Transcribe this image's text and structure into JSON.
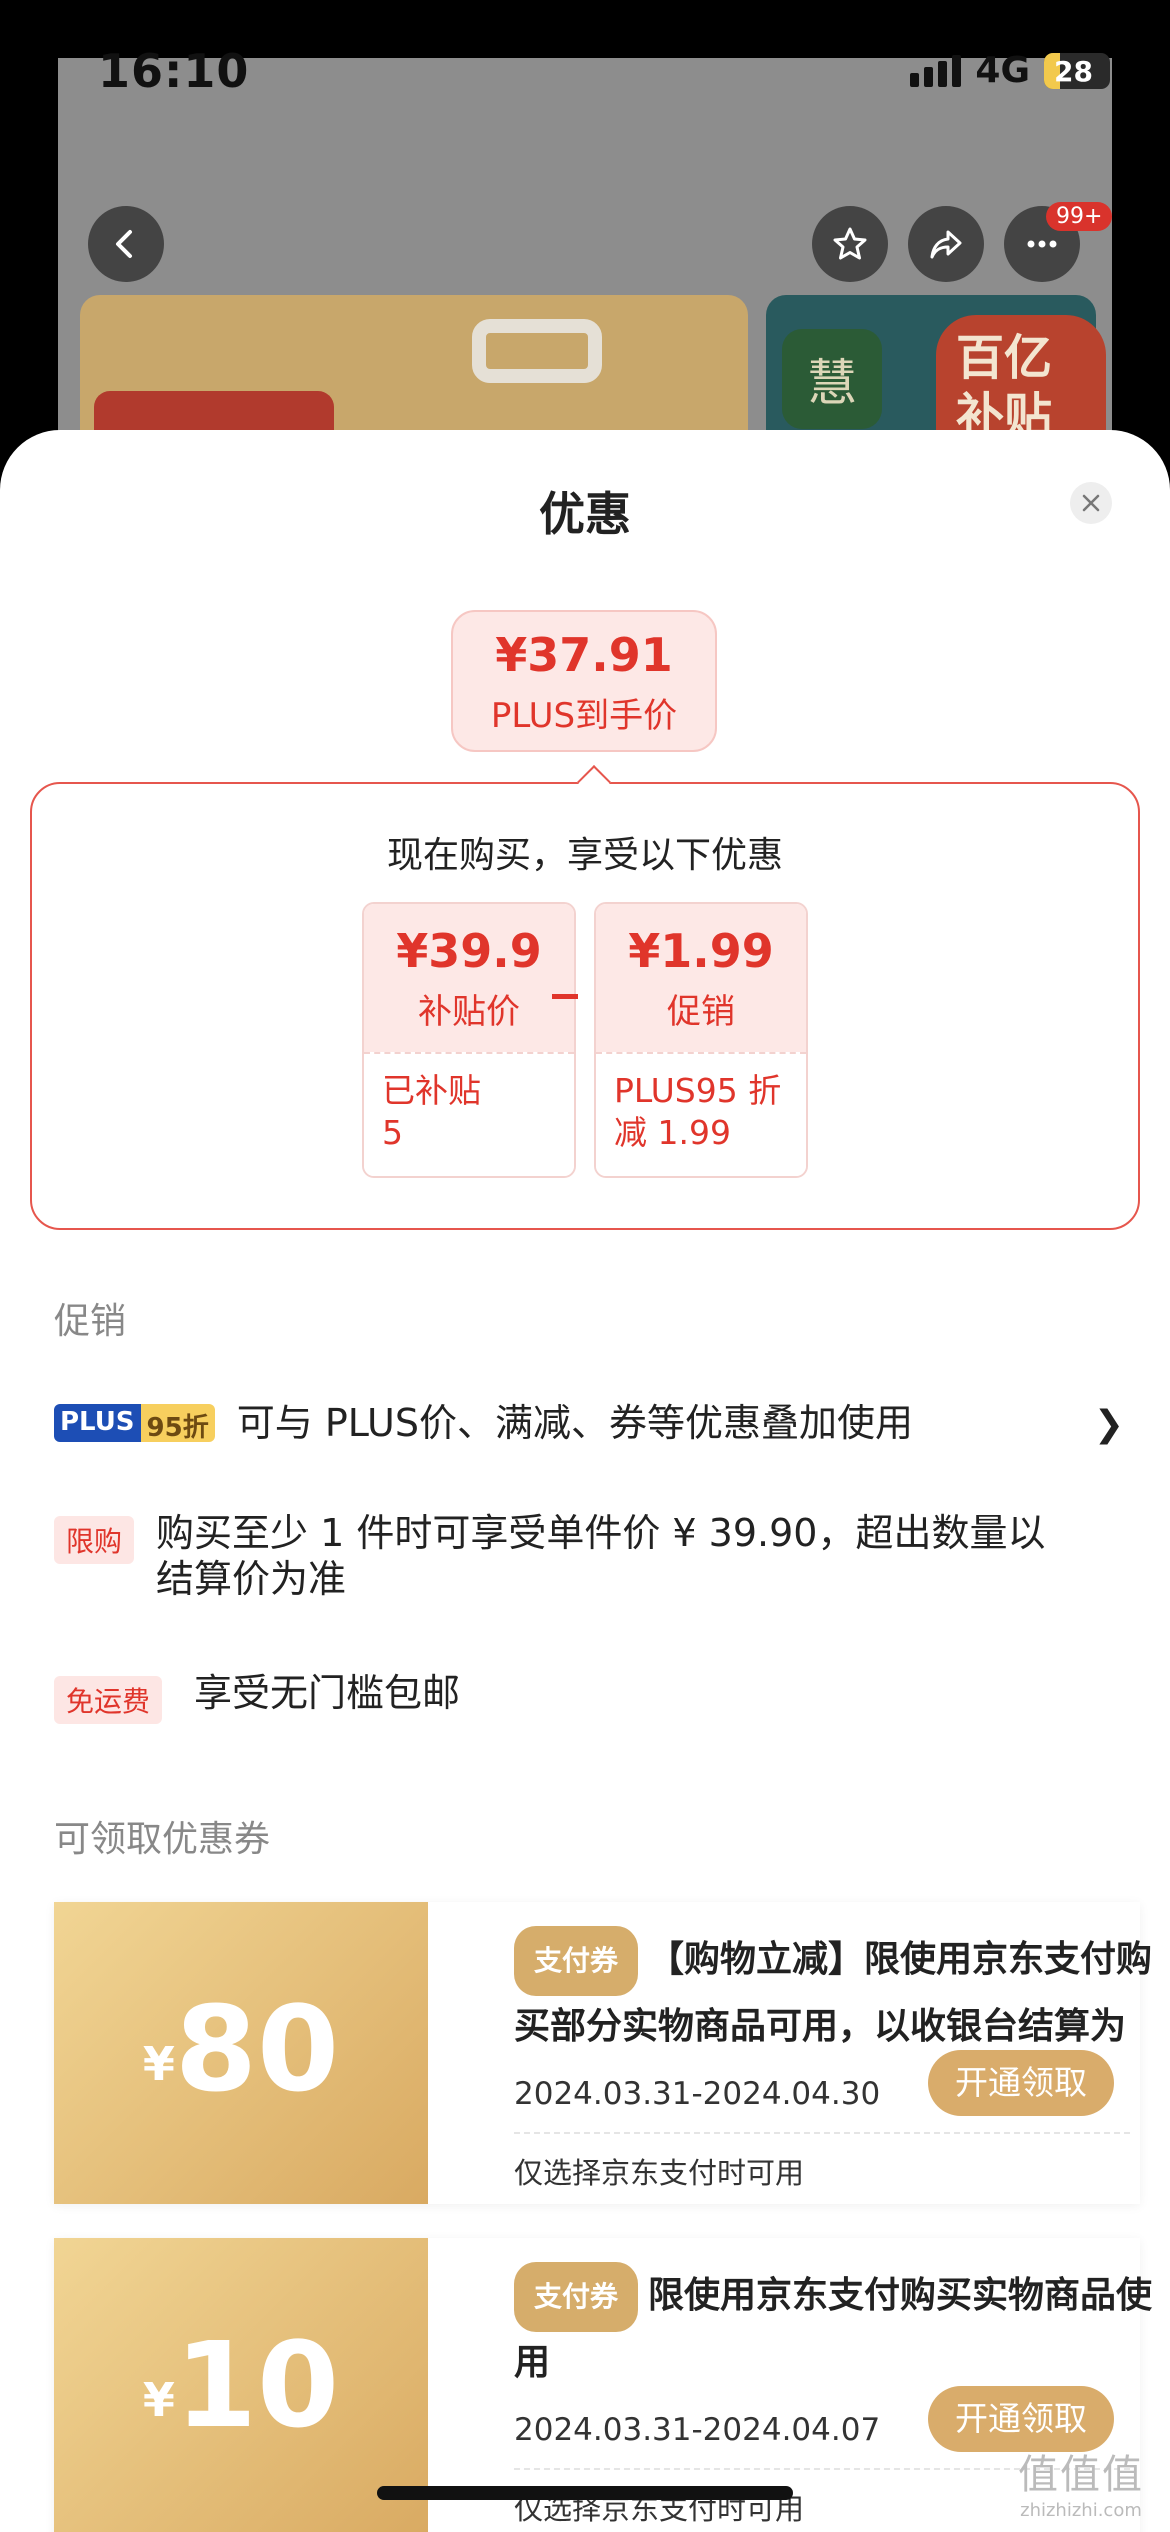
{
  "status_bar": {
    "time": "16:10",
    "network": "4G",
    "battery": "28"
  },
  "header": {
    "badge": "99+"
  },
  "product_preview": {
    "seal_char": "慧",
    "brand_text": "百亿补贴"
  },
  "sheet": {
    "title": "优惠",
    "final_price": {
      "amount": "¥37.91",
      "label": "PLUS到手价"
    },
    "breakdown": {
      "heading": "现在购买，享受以下优惠",
      "items": [
        {
          "value": "¥39.9",
          "name": "补贴价",
          "detail": "已补贴\n5"
        },
        {
          "value": "¥1.99",
          "name": "促销",
          "detail": "PLUS95 折减 1.99"
        }
      ]
    },
    "promo_section_label": "促销",
    "promos": [
      {
        "tag_a": "PLUS",
        "tag_b": "95折",
        "text": "可与 PLUS价、满减、券等优惠叠加使用"
      },
      {
        "tag": "限购",
        "text": "购买至少 1 件时可享受单件价 ¥ 39.90，超出数量以结算价为准"
      },
      {
        "tag": "免运费",
        "text": "享受无门槛包邮"
      }
    ],
    "coupon_section_label": "可领取优惠券",
    "coupons": [
      {
        "currency": "¥",
        "amount": "80",
        "tag": "支付券",
        "desc": "【购物立减】限使用京东支付购买部分实物商品可用，以收银台结算为准",
        "date": "2024.03.31-2024.04.30",
        "button": "开通领取",
        "note": "仅选择京东支付时可用"
      },
      {
        "currency": "¥",
        "amount": "10",
        "tag": "支付券",
        "desc": "限使用京东支付购买实物商品使用",
        "date": "2024.03.31-2024.04.07",
        "button": "开通领取",
        "note": "仅选择京东支付时可用"
      }
    ]
  },
  "watermark": {
    "line1": "值值值",
    "line2": "zhizhizhi.com"
  }
}
